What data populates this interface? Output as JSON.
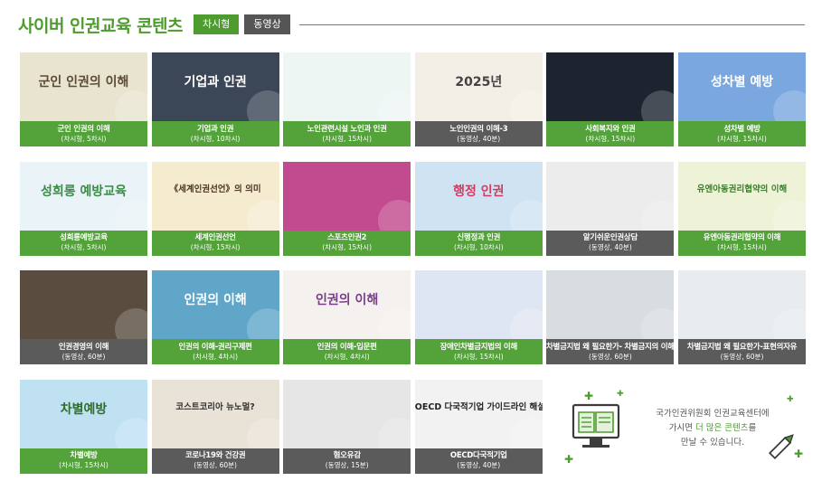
{
  "header": {
    "title": "사이버 인권교육 콘텐츠",
    "tabs": [
      {
        "label": "차시형",
        "active": true
      },
      {
        "label": "동영상",
        "active": false
      }
    ]
  },
  "cards": [
    {
      "title": "군인 인권의 이해",
      "sub": "(차시형, 5차시)",
      "type": "green",
      "thumb_text": "군인 인권의 이해",
      "thumb_bg": "#e9e4cf",
      "thumb_color": "#5c4a33"
    },
    {
      "title": "기업과 인권",
      "sub": "(차시형, 10차시)",
      "type": "green",
      "thumb_text": "기업과 인권",
      "thumb_bg": "#3b4656",
      "thumb_color": "#ffffff"
    },
    {
      "title": "노인관련시설 노인과 인권",
      "sub": "(차시형, 15차시)",
      "type": "green",
      "thumb_text": "",
      "thumb_bg": "#eef6f4",
      "thumb_color": "#444444"
    },
    {
      "title": "노인인권의 이해-3",
      "sub": "(동영상, 40분)",
      "type": "gray",
      "thumb_text": "2025년",
      "thumb_bg": "#f3efe6",
      "thumb_color": "#444444"
    },
    {
      "title": "사회복지와 인권",
      "sub": "(차시형, 15차시)",
      "type": "green",
      "thumb_text": "",
      "thumb_bg": "#1d2430",
      "thumb_color": "#ffffff"
    },
    {
      "title": "성차별 예방",
      "sub": "(차시형, 15차시)",
      "type": "green",
      "thumb_text": "성차별 예방",
      "thumb_bg": "#7aa7e0",
      "thumb_color": "#ffffff"
    },
    {
      "title": "성희롱예방교육",
      "sub": "(차시형, 5차시)",
      "type": "green",
      "thumb_text": "성희롱 예방교육",
      "thumb_bg": "#eaf3f8",
      "thumb_color": "#3a8c46"
    },
    {
      "title": "세계인권선언",
      "sub": "(차시형, 15차시)",
      "type": "green",
      "thumb_text": "《세계인권선언》의 의미",
      "thumb_bg": "#f5ecd0",
      "thumb_color": "#4a3320"
    },
    {
      "title": "스포츠인권2",
      "sub": "(차시형, 15차시)",
      "type": "green",
      "thumb_text": "",
      "thumb_bg": "#c24a8e",
      "thumb_color": "#ffffff"
    },
    {
      "title": "신행정과 인권",
      "sub": "(차시형, 10차시)",
      "type": "green",
      "thumb_text": "행정 인권",
      "thumb_bg": "#cfe3f2",
      "thumb_color": "#d7385e"
    },
    {
      "title": "알기쉬운인권상담",
      "sub": "(동영상, 40분)",
      "type": "gray",
      "thumb_text": "",
      "thumb_bg": "#ececec",
      "thumb_color": "#333333"
    },
    {
      "title": "유엔아동권리협약의 이해",
      "sub": "(차시형, 15차시)",
      "type": "green",
      "thumb_text": "유엔아동권리협약의 이해",
      "thumb_bg": "#eef3d8",
      "thumb_color": "#3a7d2a"
    },
    {
      "title": "인권경영의 이해",
      "sub": "(동영상, 60분)",
      "type": "gray",
      "thumb_text": "",
      "thumb_bg": "#5a4c3e",
      "thumb_color": "#ffffff"
    },
    {
      "title": "인권의 이해-권리구제편",
      "sub": "(차시형, 4차시)",
      "type": "green",
      "thumb_text": "인권의 이해",
      "thumb_bg": "#5fa6c9",
      "thumb_color": "#ffffff"
    },
    {
      "title": "인권의 이해-입문편",
      "sub": "(차시형, 4차시)",
      "type": "green",
      "thumb_text": "인권의 이해",
      "thumb_bg": "#f4f1ee",
      "thumb_color": "#7a3c8c"
    },
    {
      "title": "장애인차별금지법의 이해",
      "sub": "(차시형, 15차시)",
      "type": "green",
      "thumb_text": "",
      "thumb_bg": "#dfe6f3",
      "thumb_color": "#333333"
    },
    {
      "title": "차별금지법 왜 필요한가- 차별금지의 이해",
      "sub": "(동영상, 60분)",
      "type": "gray",
      "thumb_text": "",
      "thumb_bg": "#d8dde2",
      "thumb_color": "#333333"
    },
    {
      "title": "차별금지법 왜 필요한가-표현의자유",
      "sub": "(동영상, 60분)",
      "type": "gray",
      "thumb_text": "",
      "thumb_bg": "#e8ecef",
      "thumb_color": "#333333"
    },
    {
      "title": "차별예방",
      "sub": "(차시형, 15차시)",
      "type": "green",
      "thumb_text": "차별예방",
      "thumb_bg": "#bfe1f2",
      "thumb_color": "#2f6d2a"
    },
    {
      "title": "코로나19와 건강권",
      "sub": "(동영상, 60분)",
      "type": "gray",
      "thumb_text": "코스트코리아 뉴노멀?",
      "thumb_bg": "#e9e2d7",
      "thumb_color": "#333333"
    },
    {
      "title": "혐오유감",
      "sub": "(동영상, 15분)",
      "type": "gray",
      "thumb_text": "",
      "thumb_bg": "#e6e6e6",
      "thumb_color": "#333333"
    },
    {
      "title": "OECD다국적기업",
      "sub": "(동영상, 40분)",
      "type": "gray",
      "thumb_text": "OECD 다국적기업 가이드라인 해설",
      "thumb_bg": "#f2f2f2",
      "thumb_color": "#222222"
    }
  ],
  "promo": {
    "line1": "국가인권위원회 인권교육센터에",
    "line2_pre": "가시면 ",
    "line2_hl": "더 많은 콘텐츠",
    "line2_post": "를",
    "line3": "만날 수 있습니다.",
    "accent": "#4e9b2f"
  }
}
